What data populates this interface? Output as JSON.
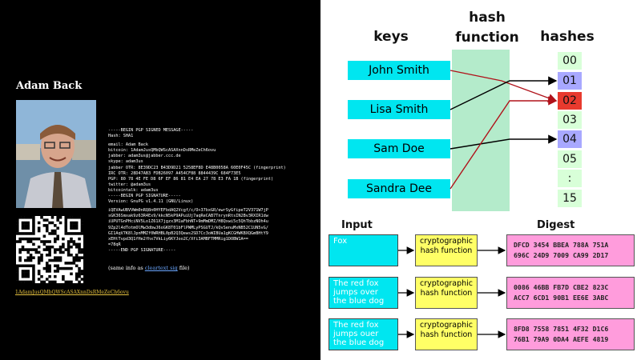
{
  "profile": {
    "name": "Adam Back",
    "bitcoin_link": "1AdamJusQMbQWScASAXnnDsRMeZeCh6ovu",
    "same_info_prefix": "(same info as ",
    "same_info_link": "cleartext sig",
    "same_info_suffix": " file)",
    "pgp_block": [
      "-----BEGIN PGP SIGNED MESSAGE-----",
      "Hash: SHA1",
      "",
      "email: Adam Back",
      "bitcoin: 1AdamJusQMbQWScASAXnnDsRMeZeCh6ovu",
      "jabber: adam3us@jabber.ccc.de",
      "skype: adam3us",
      "jabber OTR: 8E39DC23 B43D9D21 5258EF8D E48B0058A 60E0F45C (fingerprint)",
      "IRC OTR: 28D47AB3 FDB26097 A454CF88 8844439C 684F73E5",
      "PGP: 80 78 4E FE D8 6F EF 86 81 E4 EA 27 78 E3 FA 1B (fingerprint)",
      "twitter: @adam3us",
      "bitcointalk: adam3us",
      "-----BEGIN PGP SIGNATURE-----",
      "Version: GnuPG v1.4.11 (GNU/Linux)",
      "",
      "iQEVAwUBVVWm0nRQ8n0HYEFbdAQ2Vcgf/c/O+37bxGR/ewrSyGfipeT2V371W7jP",
      "sGK36Smxak9z63R4Ex9/kkcN5kP9APuiUj7aqReCAB7TnrynRtsIN2Bv3RXIR1dw",
      "iUPUTGnPHciNV5Lo1Z61X7jgzx3M1aFbhNT+9mMmDMZ/H8Qxwi5c5QhTbbzNOh4u",
      "9Zp2l4dTotmOlMw3dbwJ6oGK8T01bFlPWMLyPSGUTJ/kQvSenuMxNB52C1UN5vG/",
      "GI1AqV7K8lJpnMMZf0WRHBL0pB2Q3Qews2SD7Cc3oWIBUa1gKCGHWKBXQGmBHtY9",
      "xEHtTvpd3Q1fHe2fhx7VkLiy6KYJoo2C/Xfi3AMBFTMMRig1DOBW1A==",
      "=78qR",
      "-----END PGP SIGNATURE-----"
    ]
  },
  "hash_table": {
    "header_keys": "keys",
    "header_hash_function_line1": "hash",
    "header_hash_function_line2": "function",
    "header_hashes": "hashes",
    "keys": [
      "John Smith",
      "Lisa Smith",
      "Sam Doe",
      "Sandra Dee"
    ],
    "hashes": [
      "00",
      "01",
      "02",
      "03",
      "04",
      "05",
      ":",
      "15"
    ],
    "highlight_colors": {
      "01": "#a8a8ff",
      "02": "#e83a2e",
      "04": "#a8a8ff",
      "default": "#d8ffd8"
    },
    "key_color": "#00e6f0",
    "band_color": "#b4ebcb",
    "mappings": [
      {
        "key": "John Smith",
        "hash": "02",
        "color": "#b0121a"
      },
      {
        "key": "Lisa Smith",
        "hash": "01",
        "color": "#000000"
      },
      {
        "key": "Sam Doe",
        "hash": "04",
        "color": "#000000"
      },
      {
        "key": "Sandra Dee",
        "hash": "02",
        "color": "#b0121a"
      }
    ]
  },
  "digest_diagram": {
    "title_input": "Input",
    "title_digest": "Digest",
    "hash_label": "cryptographic hash function",
    "rows": [
      {
        "input": "Fox",
        "digest_line1": "DFCD 3454 BBEA 788A 751A",
        "digest_line2": "696C 24D9 7009 CA99 2D17"
      },
      {
        "input": "The red fox jumps over the blue dog",
        "digest_line1": "0086 46BB FB7D CBE2 823C",
        "digest_line2": "ACC7 6CD1 90B1 EE6E 3ABC"
      },
      {
        "input": "The red fox jumps ouer the blue dog",
        "digest_line1": "8FD8 7558 7851 4F32 D1C6",
        "digest_line2": "76B1 79A9 0DA4 AEFE 4819"
      }
    ],
    "colors": {
      "input": "#00e6f0",
      "hash": "#ffff66",
      "digest": "#ff9cdc"
    }
  }
}
